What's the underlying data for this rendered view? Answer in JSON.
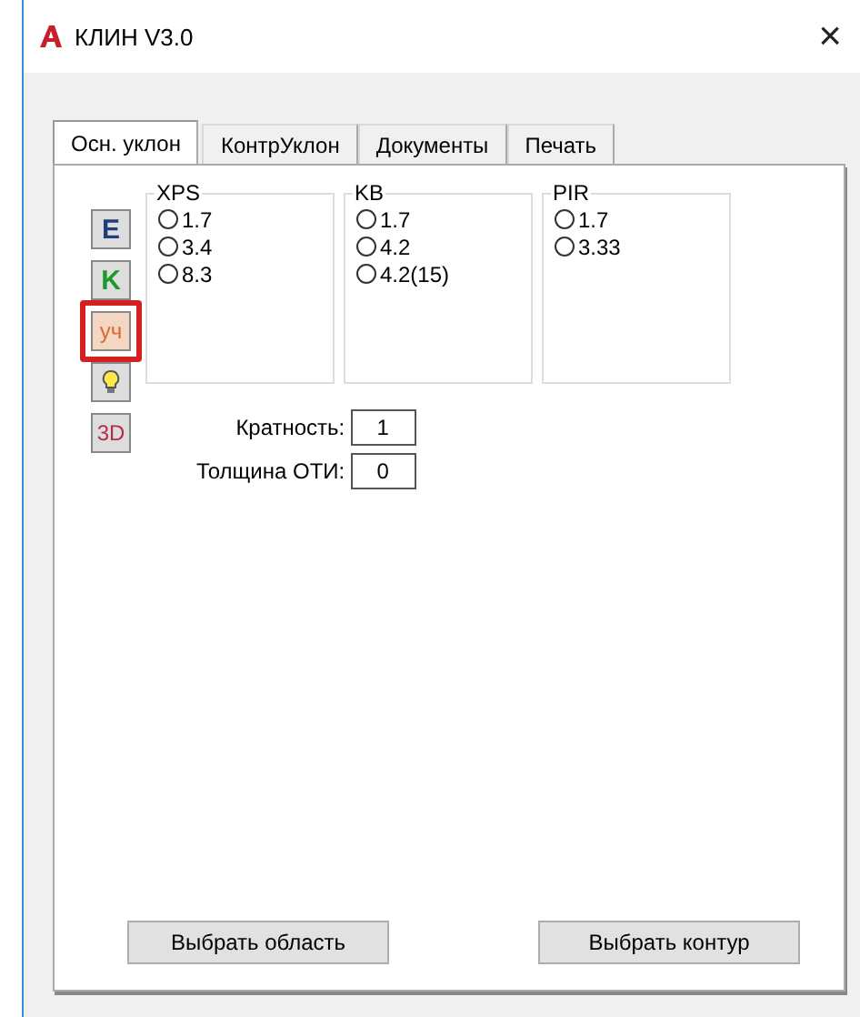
{
  "window": {
    "title": "КЛИН V3.0",
    "close": "×"
  },
  "tabs": [
    {
      "label": "Осн. уклон",
      "selected": true
    },
    {
      "label": "КонтрУклон",
      "selected": false
    },
    {
      "label": "Документы",
      "selected": false
    },
    {
      "label": "Печать",
      "selected": false
    }
  ],
  "tools": [
    {
      "kind": "letter",
      "label": "E",
      "color": "#1f3f7a",
      "selected": false
    },
    {
      "kind": "letter",
      "label": "K",
      "color": "#1a9a2a",
      "selected": false
    },
    {
      "kind": "letter",
      "label": "уч",
      "color": "#d9682a",
      "selected": true
    },
    {
      "kind": "bulb",
      "selected": false
    },
    {
      "kind": "arrow-letter",
      "label": "3D",
      "color": "#b0304a",
      "selected": false
    }
  ],
  "groups": [
    {
      "title": "XPS",
      "options": [
        {
          "label": "1.7",
          "selected": false
        },
        {
          "label": "3.4",
          "selected": false
        },
        {
          "label": "8.3",
          "selected": false
        }
      ]
    },
    {
      "title": "KB",
      "options": [
        {
          "label": "1.7",
          "selected": false
        },
        {
          "label": "4.2",
          "selected": false
        },
        {
          "label": "4.2(15)",
          "selected": false
        }
      ]
    },
    {
      "title": "PIR",
      "options": [
        {
          "label": "1.7",
          "selected": false
        },
        {
          "label": "3.33",
          "selected": false
        }
      ]
    }
  ],
  "fields": [
    {
      "label": "Кратность:",
      "value": "1"
    },
    {
      "label": "Толщина ОТИ:",
      "value": "0"
    }
  ],
  "buttons": [
    "Выбрать область",
    "Выбрать контур"
  ]
}
